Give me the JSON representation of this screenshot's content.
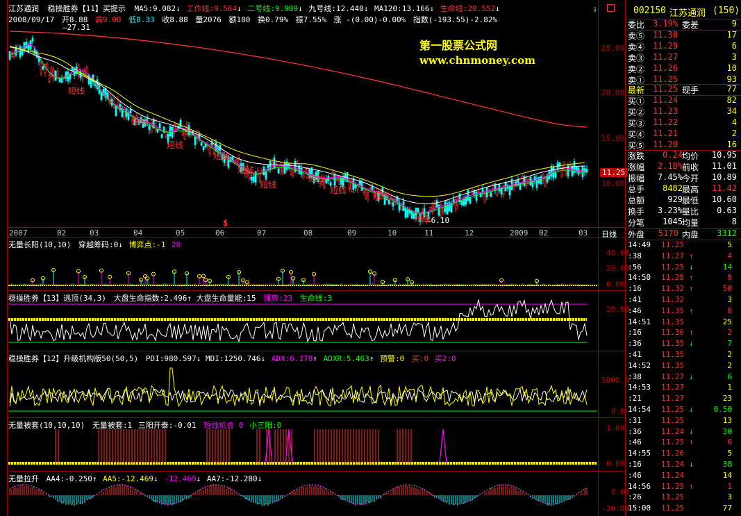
{
  "colors": {
    "up": "#ff3232",
    "down": "#00ffff",
    "yellow": "#ffff00",
    "white": "#ffffff",
    "green": "#00ff00",
    "magenta": "#ff00ff",
    "grid": "#a00000",
    "blue": "#00a0ff"
  },
  "main": {
    "stock_name": "江苏通润",
    "indicator": "稳操胜券【11】买提示",
    "ma5": "MA5:9.082",
    "work": "工作线:9.564",
    "line2": "二号线:9.989",
    "line9": "九号线:12.440",
    "ma120": "MA120:13.166",
    "life": "生命线:20.552",
    "date": "2008/09/17",
    "open": "开8.88",
    "high": "高9.00",
    "low": "低8.33",
    "close": "收8.88",
    "vol": "量2076",
    "amount": "额180",
    "turnover": "换0.79%",
    "amplitude": "振7.55%",
    "change": "涨 -(0.00)-0.00%",
    "index": "指数(-193.55)-2.82%",
    "max_label": "27.31",
    "min_label": "6.10",
    "price_tag": "11.25",
    "y_ticks": [
      "25.00",
      "20.00",
      "15.00",
      "10.00"
    ],
    "short_labels": [
      "短线",
      "短线",
      "短线",
      "短线",
      "短线",
      "短线",
      "短线",
      "短线",
      "短线",
      "短线"
    ],
    "watermark_cn": "第一股票公式网",
    "watermark_url": "www.chnmoney.com",
    "dollar": "$"
  },
  "x_axis": {
    "labels": [
      "2007",
      "02",
      "03",
      "04",
      "05",
      "06",
      "07",
      "08",
      "09",
      "10",
      "11",
      "12",
      "2009",
      "02",
      "03"
    ],
    "period": "日线"
  },
  "panel1": {
    "title": "无量长阳",
    "params": "(10,10)",
    "a": "穿越筹码:0",
    "b": "博弈点:-1",
    "c": "20",
    "ticks": [
      "40.00",
      "20.00",
      "0.00"
    ]
  },
  "panel2": {
    "title": "稳操胜券【13】逃顶",
    "params": "(34,3)",
    "a": "大盘生命指数:2.496",
    "b": "大盘生命量能:15",
    "c": "强势:23",
    "d": "生命线:3",
    "ticks": [
      "20.00"
    ]
  },
  "panel3": {
    "title": "稳操胜券【12】升级机构版50",
    "params": "(50,5)",
    "a": "PDI:980.597",
    "b": "MDI:1250.746",
    "c": "ADX:6.178",
    "d": "ADXR:5.463",
    "e": "预警:0",
    "f": "买:0",
    "g": "买2:0",
    "ticks": [
      "5000.0",
      "0.0"
    ]
  },
  "panel4": {
    "title": "无量被套",
    "params": "(10,10,10)",
    "a": "无量被套:1",
    "b": "三阳开泰:-0.01",
    "c": "短线机会 0",
    "d": "小三阳:0",
    "ticks": [
      "1.00",
      "0.00"
    ]
  },
  "panel5": {
    "title": "无量拉升",
    "a": "AA4:-0.250",
    "b": "AA5:-12.469",
    "c": "-12.469",
    "d": "AA7:-12.280",
    "ticks": [
      "0.00",
      "-20.00"
    ]
  },
  "quote": {
    "code": "002150",
    "name": "江苏通润",
    "count": "(150)",
    "weibi_label": "委比",
    "weibi": "3.19%",
    "weicha_label": "委差",
    "weicha": "9",
    "asks": [
      {
        "label": "卖⑤",
        "price": "11.30",
        "vol": "17"
      },
      {
        "label": "卖④",
        "price": "11.29",
        "vol": "6"
      },
      {
        "label": "卖③",
        "price": "11.27",
        "vol": "3"
      },
      {
        "label": "卖②",
        "price": "11.26",
        "vol": "10"
      },
      {
        "label": "卖①",
        "price": "11.25",
        "vol": "93"
      }
    ],
    "last_label": "最新",
    "last": "11.25",
    "now_label": "现手",
    "now": "77",
    "bids": [
      {
        "label": "买①",
        "price": "11.24",
        "vol": "82"
      },
      {
        "label": "买②",
        "price": "11.23",
        "vol": "34"
      },
      {
        "label": "买③",
        "price": "11.22",
        "vol": "4"
      },
      {
        "label": "买④",
        "price": "11.21",
        "vol": "2"
      },
      {
        "label": "买⑤",
        "price": "11.20",
        "vol": "16"
      }
    ],
    "stats": [
      {
        "l1": "涨跌",
        "v1": "0.24",
        "l2": "均价",
        "v2": "10.95"
      },
      {
        "l1": "涨幅",
        "v1": "2.18%",
        "l2": "前收",
        "v2": "11.01"
      },
      {
        "l1": "振幅",
        "v1": "7.45%",
        "l2": "今开",
        "v2": "10.89"
      },
      {
        "l1": "总手",
        "v1": "8482",
        "l2": "最高",
        "v2": "11.42"
      },
      {
        "l1": "总额",
        "v1": "929",
        "l2": "最低",
        "v2": "10.60"
      },
      {
        "l1": "换手",
        "v1": "3.23%",
        "l2": "量比",
        "v2": "0.63"
      },
      {
        "l1": "分笔",
        "v1": "1045",
        "l2": "均量",
        "v2": "8"
      }
    ],
    "outer_label": "外盘",
    "outer": "5170",
    "inner_label": "内盘",
    "inner": "3312",
    "ticks": [
      {
        "t": "14:49",
        "p": "11.25",
        "a": "",
        "v": "5"
      },
      {
        "t": ":38",
        "p": "11.27",
        "a": "↑",
        "v": "4"
      },
      {
        "t": ":56",
        "p": "11.25",
        "a": "↓",
        "v": "14"
      },
      {
        "t": "14:50",
        "p": "11.28",
        "a": "↑",
        "v": "8"
      },
      {
        "t": ":16",
        "p": "11.32",
        "a": "↑",
        "v": "50"
      },
      {
        "t": ":41",
        "p": "11.32",
        "a": "",
        "v": "3"
      },
      {
        "t": ":46",
        "p": "11.35",
        "a": "↑",
        "v": "8"
      },
      {
        "t": "14:51",
        "p": "11.35",
        "a": "",
        "v": "25"
      },
      {
        "t": ":16",
        "p": "11.36",
        "a": "↑",
        "v": "2"
      },
      {
        "t": ":36",
        "p": "11.35",
        "a": "↓",
        "v": "7"
      },
      {
        "t": ":41",
        "p": "11.35",
        "a": "",
        "v": "2"
      },
      {
        "t": "14:52",
        "p": "11.35",
        "a": "",
        "v": "2"
      },
      {
        "t": ":38",
        "p": "11.27",
        "a": "↓",
        "v": "6"
      },
      {
        "t": "14:53",
        "p": "11.27",
        "a": "",
        "v": "1"
      },
      {
        "t": ":21",
        "p": "11.27",
        "a": "",
        "v": "23"
      },
      {
        "t": "14:54",
        "p": "11.25",
        "a": "↓",
        "v": "0.50"
      },
      {
        "t": ":31",
        "p": "11.25",
        "a": "",
        "v": "13"
      },
      {
        "t": ":36",
        "p": "11.24",
        "a": "↓",
        "v": "30"
      },
      {
        "t": ":46",
        "p": "11.25",
        "a": "↑",
        "v": "6"
      },
      {
        "t": "14:55",
        "p": "11.26",
        "a": "",
        "v": "5"
      },
      {
        "t": ":16",
        "p": "11.24",
        "a": "↓",
        "v": "38"
      },
      {
        "t": ":46",
        "p": "11.24",
        "a": "",
        "v": "14"
      },
      {
        "t": "14:56",
        "p": "11.25",
        "a": "↑",
        "v": "1"
      },
      {
        "t": ":26",
        "p": "11.25",
        "a": "",
        "v": "3"
      },
      {
        "t": "15:00",
        "p": "11.25",
        "a": "",
        "v": "77"
      }
    ]
  }
}
